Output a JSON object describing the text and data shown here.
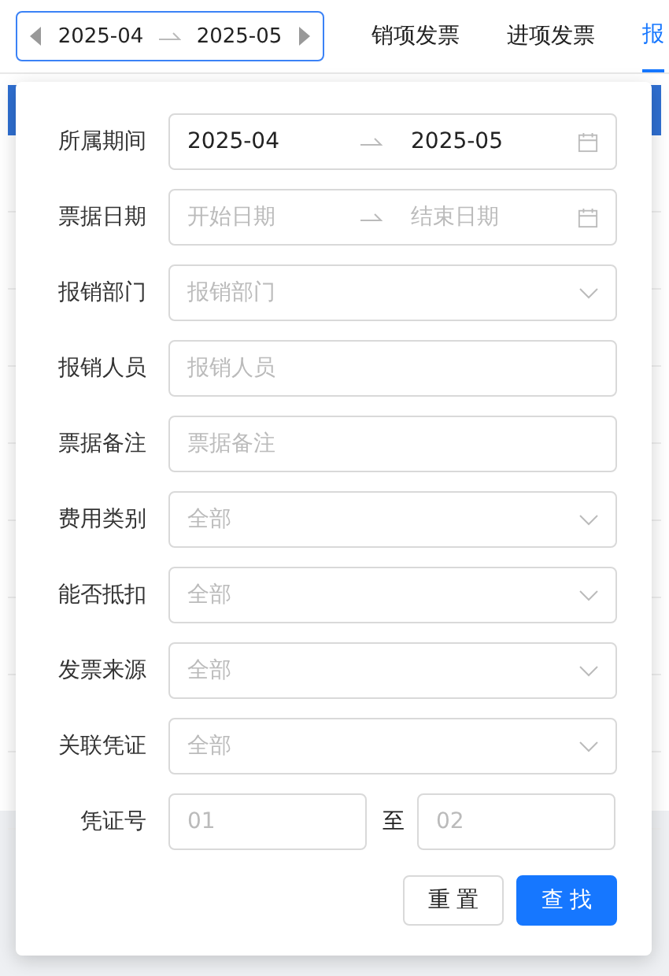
{
  "period_picker": {
    "start": "2025-04",
    "end": "2025-05"
  },
  "tabs": [
    {
      "label": "销项发票",
      "selected": false
    },
    {
      "label": "进项发票",
      "selected": false
    },
    {
      "label": "报",
      "selected": true
    }
  ],
  "filter": {
    "fields": [
      {
        "label": "所属期间",
        "kind": "range",
        "start": "2025-04",
        "end": "2025-05"
      },
      {
        "label": "票据日期",
        "kind": "range",
        "start_placeholder": "开始日期",
        "end_placeholder": "结束日期"
      },
      {
        "label": "报销部门",
        "kind": "select",
        "placeholder": "报销部门"
      },
      {
        "label": "报销人员",
        "kind": "text",
        "placeholder": "报销人员"
      },
      {
        "label": "票据备注",
        "kind": "text",
        "placeholder": "票据备注"
      },
      {
        "label": "费用类别",
        "kind": "select",
        "placeholder": "全部"
      },
      {
        "label": "能否抵扣",
        "kind": "select",
        "placeholder": "全部"
      },
      {
        "label": "发票来源",
        "kind": "select",
        "placeholder": "全部"
      },
      {
        "label": "关联凭证",
        "kind": "select",
        "placeholder": "全部"
      }
    ],
    "voucher": {
      "label": "凭证号",
      "from_placeholder": "01",
      "separator": "至",
      "to_placeholder": "02"
    },
    "buttons": [
      {
        "label": "重置",
        "kind": "secondary"
      },
      {
        "label": "查找",
        "kind": "primary"
      }
    ]
  }
}
